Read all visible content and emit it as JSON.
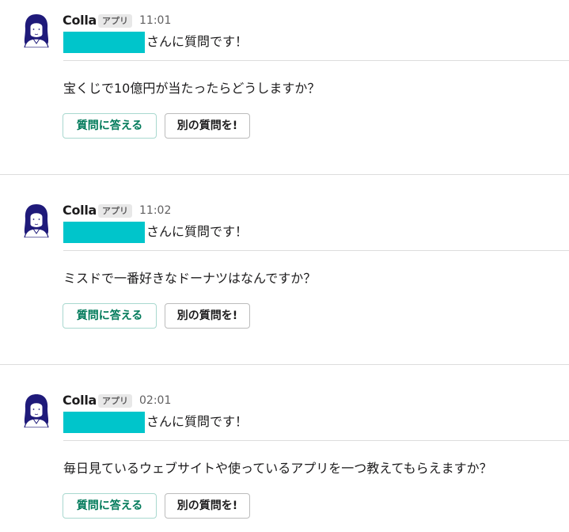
{
  "messages": [
    {
      "sender": "Colla",
      "badge": "アプリ",
      "time": "11:01",
      "mention_suffix": "さんに質問です！",
      "question": "宝くじで10億円が当たったらどうしますか？",
      "answer_label": "質問に答える",
      "other_label": "別の質問を!"
    },
    {
      "sender": "Colla",
      "badge": "アプリ",
      "time": "11:02",
      "mention_suffix": "さんに質問です！",
      "question": "ミスドで一番好きなドーナツはなんですか？",
      "answer_label": "質問に答える",
      "other_label": "別の質問を!"
    },
    {
      "sender": "Colla",
      "badge": "アプリ",
      "time": "02:01",
      "mention_suffix": "さんに質問です！",
      "question": "毎日見ているウェブサイトや使っているアプリを一つ教えてもらえますか？",
      "answer_label": "質問に答える",
      "other_label": "別の質問を!"
    }
  ],
  "colors": {
    "mention_highlight": "#00c5cb",
    "answer_button_text": "#007a5a",
    "avatar_hair": "#1f1a7a"
  },
  "icons": {
    "avatar": "woman-avatar-icon"
  }
}
